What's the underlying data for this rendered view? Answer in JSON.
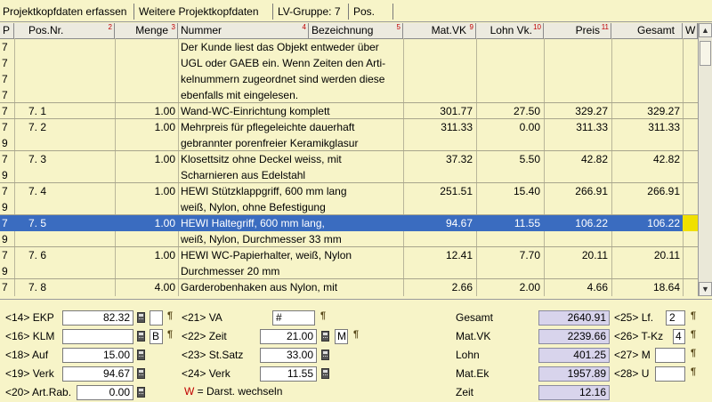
{
  "tabs": [
    {
      "label": "Projektkopfdaten erfassen"
    },
    {
      "label": "Weitere Projektkopfdaten"
    },
    {
      "label": "LV-Gruppe: 7"
    },
    {
      "label": "Pos."
    }
  ],
  "columns": [
    {
      "label": "P",
      "num": ""
    },
    {
      "label": "Pos.Nr.",
      "num": "2"
    },
    {
      "label": "Menge",
      "num": "3"
    },
    {
      "label": "Nummer",
      "num": "4"
    },
    {
      "label": "Bezeichnung",
      "num": "5"
    },
    {
      "label": "Mat.VK",
      "num": "9"
    },
    {
      "label": "Lohn Vk.",
      "num": "10"
    },
    {
      "label": "Preis",
      "num": "11"
    },
    {
      "label": "Gesamt",
      "num": ""
    },
    {
      "label": "W",
      "num": ""
    }
  ],
  "rows": [
    {
      "p": [
        "7",
        "7",
        "7",
        "7"
      ],
      "pos": "",
      "menge": "",
      "text": [
        "Der Kunde liest das Objekt entweder über",
        "UGL oder GAEB ein. Wenn Zeiten den Arti-",
        "kelnummern zugeordnet sind werden diese",
        "ebenfalls mit eingelesen."
      ],
      "matvk": "",
      "lohn": "",
      "preis": "",
      "gesamt": "",
      "selected": false
    },
    {
      "p": [
        "7"
      ],
      "pos": "7. 1",
      "menge": "1.00",
      "text": [
        "Wand-WC-Einrichtung komplett"
      ],
      "matvk": "301.77",
      "lohn": "27.50",
      "preis": "329.27",
      "gesamt": "329.27",
      "selected": false
    },
    {
      "p": [
        "7",
        "9"
      ],
      "pos": "7. 2",
      "menge": "1.00",
      "text": [
        "Mehrpreis für pflegeleichte dauerhaft",
        "gebrannter  porenfreier Keramikglasur"
      ],
      "matvk": "311.33",
      "lohn": "0.00",
      "preis": "311.33",
      "gesamt": "311.33",
      "selected": false
    },
    {
      "p": [
        "7",
        "9"
      ],
      "pos": "7. 3",
      "menge": "1.00",
      "text": [
        "Klosettsitz ohne Deckel weiss, mit",
        "Scharnieren aus Edelstahl"
      ],
      "matvk": "37.32",
      "lohn": "5.50",
      "preis": "42.82",
      "gesamt": "42.82",
      "selected": false
    },
    {
      "p": [
        "7",
        "9"
      ],
      "pos": "7. 4",
      "menge": "1.00",
      "text": [
        "HEWI Stützklappgriff, 600 mm lang",
        "weiß, Nylon, ohne Befestigung"
      ],
      "matvk": "251.51",
      "lohn": "15.40",
      "preis": "266.91",
      "gesamt": "266.91",
      "selected": false
    },
    {
      "p": [
        "7",
        "9"
      ],
      "pos": "7. 5",
      "menge": "1.00",
      "text": [
        "HEWI Haltegriff, 600 mm lang,",
        "weiß, Nylon, Durchmesser 33 mm"
      ],
      "matvk": "94.67",
      "lohn": "11.55",
      "preis": "106.22",
      "gesamt": "106.22",
      "selected": true
    },
    {
      "p": [
        "7",
        "9"
      ],
      "pos": "7. 6",
      "menge": "1.00",
      "text": [
        "HEWI WC-Papierhalter, weiß, Nylon",
        "Durchmesser 20 mm"
      ],
      "matvk": "12.41",
      "lohn": "7.70",
      "preis": "20.11",
      "gesamt": "20.11",
      "selected": false
    },
    {
      "p": [
        "7"
      ],
      "pos": "7. 8",
      "menge": "4.00",
      "text": [
        "Garderobenhaken aus Nylon, mit"
      ],
      "matvk": "2.66",
      "lohn": "2.00",
      "preis": "4.66",
      "gesamt": "18.64",
      "selected": false
    }
  ],
  "form": {
    "ekp_label": "<14> EKP",
    "ekp_value": "82.32",
    "klm_label": "<16> KLM",
    "klm_value": "",
    "klm_flag": "B",
    "auf_label": "<18> Auf",
    "auf_value": "15.00",
    "verk_label": "<19> Verk",
    "verk_value": "94.67",
    "artrab_label": "<20> Art.Rab.",
    "artrab_value": "0.00",
    "va_label": "<21> VA",
    "va_value": "#",
    "zeit_label": "<22> Zeit",
    "zeit_value": "21.00",
    "zeit_flag": "M",
    "stsatz_label": "<23> St.Satz",
    "stsatz_value": "33.00",
    "verk24_label": "<24> Verk",
    "verk24_value": "11.55",
    "hint_w": "W",
    "hint_text": " = Darst. wechseln"
  },
  "totals": {
    "gesamt_label": "Gesamt",
    "gesamt_value": "2640.91",
    "matvk_label": "Mat.VK",
    "matvk_value": "2239.66",
    "lohn_label": "Lohn",
    "lohn_value": "401.25",
    "matek_label": "Mat.Ek",
    "matek_value": "1957.89",
    "zeit_label": "Zeit",
    "zeit_value": "12.16",
    "lf_label": "<25> Lf.",
    "lf_value": "2",
    "tkz_label": "<26> T-Kz",
    "tkz_value": "4",
    "m27_label": "<27> M",
    "m27_value": "",
    "u28_label": "<28> U",
    "u28_value": ""
  },
  "colors": {
    "selected_row": "#3a6cc0",
    "highlight_w": "#f0e000",
    "background": "#f7f4c8",
    "readonly": "#d8d4ec"
  }
}
